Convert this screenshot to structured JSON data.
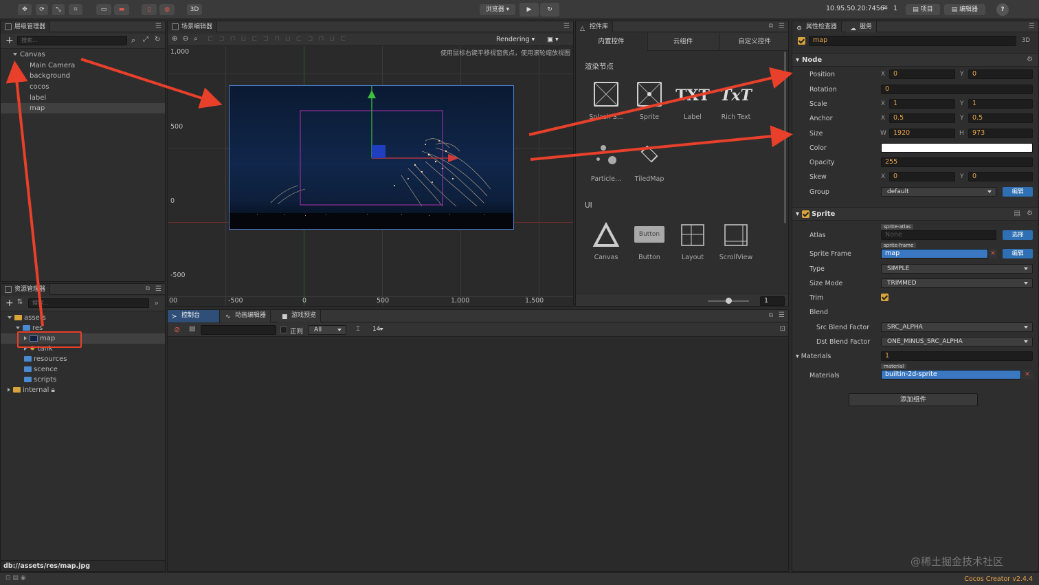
{
  "topbar": {
    "mode_3d": "3D",
    "browser_dropdown": "浏览器 ▾",
    "ip": "10.95.50.20:7456",
    "conn_count": "1",
    "project_btn": "项目",
    "editor_btn": "编辑器",
    "help": "?"
  },
  "hierarchy": {
    "title": "层级管理器",
    "search_placeholder": "搜索...",
    "items": [
      "Canvas",
      "Main Camera",
      "background",
      "cocos",
      "label",
      "map"
    ]
  },
  "assets": {
    "title": "资源管理器",
    "search_placeholder": "搜索...",
    "items": [
      "assets",
      "res",
      "map",
      "tank",
      "resources",
      "scence",
      "scripts",
      "internal"
    ],
    "footer_path": "db://assets/res/map.jpg"
  },
  "scene": {
    "title": "场景编辑器",
    "rendering_label": "Rendering",
    "hint": "使用鼠标右键平移视窗焦点，使用滚轮缩放视图",
    "y_labels": [
      "1,000",
      "500",
      "0",
      "-500"
    ],
    "x_labels": [
      "00",
      "-500",
      "0",
      "500",
      "1,000",
      "1,500"
    ]
  },
  "library": {
    "title": "控件库",
    "tabs": [
      "内置控件",
      "云组件",
      "自定义控件"
    ],
    "section_render": "渲染节点",
    "section_ui": "UI",
    "render_items": [
      "Splash S...",
      "Sprite",
      "Label",
      "Rich Text",
      "Particle...",
      "TiledMap"
    ],
    "ui_items": [
      "Canvas",
      "Button",
      "Layout",
      "ScrollView"
    ],
    "button_text": "Button",
    "zoom_value": "1",
    "txt_glyph": "TXT",
    "rich_glyph": "TxT"
  },
  "console": {
    "tabs": [
      "控制台",
      "动画编辑器",
      "游戏预览"
    ],
    "regex_label": "正则",
    "level": "All",
    "font_size": "14"
  },
  "inspector": {
    "tabs": [
      "属性检查器",
      "服务"
    ],
    "node_name": "map",
    "tag_3d": "3D",
    "node_section": "Node",
    "labels": {
      "position": "Position",
      "rotation": "Rotation",
      "scale": "Scale",
      "anchor": "Anchor",
      "size": "Size",
      "color": "Color",
      "opacity": "Opacity",
      "skew": "Skew",
      "group": "Group",
      "atlas": "Atlas",
      "sprite_frame": "Sprite Frame",
      "type": "Type",
      "size_mode": "Size Mode",
      "trim": "Trim",
      "blend": "Blend",
      "src_blend": "Src Blend Factor",
      "dst_blend": "Dst Blend Factor",
      "materials_section": "Materials",
      "materials": "Materials"
    },
    "axis": {
      "x": "X",
      "y": "Y",
      "w": "W",
      "h": "H"
    },
    "position": {
      "x": "0",
      "y": "0"
    },
    "rotation": "0",
    "scale": {
      "x": "1",
      "y": "1"
    },
    "anchor": {
      "x": "0.5",
      "y": "0.5"
    },
    "size": {
      "w": "1920",
      "h": "973"
    },
    "opacity": "255",
    "skew": {
      "x": "0",
      "y": "0"
    },
    "group": "default",
    "edit_btn": "编辑",
    "select_btn": "选择",
    "sprite_section": "Sprite",
    "atlas_tag": "sprite-atlas",
    "atlas_value": "None",
    "frame_tag": "sprite-frame",
    "frame_value": "map",
    "type_value": "SIMPLE",
    "size_mode_value": "TRIMMED",
    "src_blend_value": "SRC_ALPHA",
    "dst_blend_value": "ONE_MINUS_SRC_ALPHA",
    "materials_count": "1",
    "material_tag": "material",
    "material_value": "builtin-2d-sprite",
    "add_component": "添加组件"
  },
  "footer": {
    "watermark": "@稀土掘金技术社区",
    "version": "Cocos Creator v2.4.4"
  },
  "colors": {
    "accent_orange": "#e6a44a",
    "selection_blue": "#2f6fb3",
    "annotation_red": "#e8402a"
  }
}
